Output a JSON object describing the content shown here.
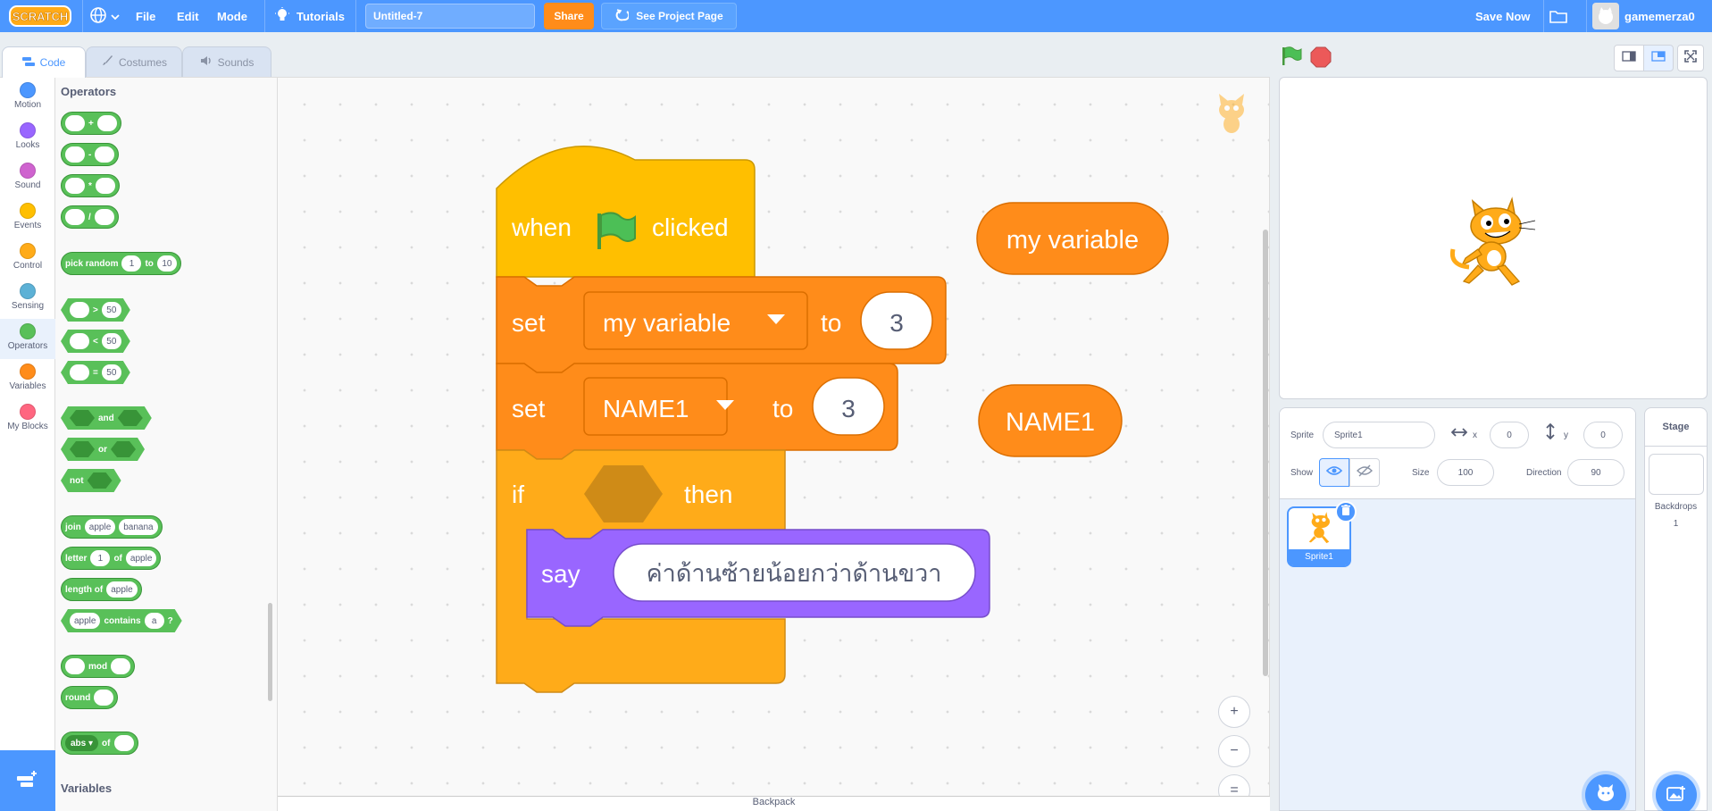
{
  "menubar": {
    "logo_text": "SCRATCH",
    "file": "File",
    "edit": "Edit",
    "mode": "Mode",
    "tutorials": "Tutorials",
    "project_title": "Untitled-7",
    "share": "Share",
    "see_project_page": "See Project Page",
    "save_now": "Save Now",
    "username": "gamemerza0"
  },
  "tabs": {
    "code": "Code",
    "costumes": "Costumes",
    "sounds": "Sounds"
  },
  "categories": [
    {
      "label": "Motion",
      "color": "#4c97ff"
    },
    {
      "label": "Looks",
      "color": "#9966ff"
    },
    {
      "label": "Sound",
      "color": "#cf63cf"
    },
    {
      "label": "Events",
      "color": "#ffbf00"
    },
    {
      "label": "Control",
      "color": "#ffab19"
    },
    {
      "label": "Sensing",
      "color": "#5cb1d6"
    },
    {
      "label": "Operators",
      "color": "#59c059"
    },
    {
      "label": "Variables",
      "color": "#ff8c1a"
    },
    {
      "label": "My Blocks",
      "color": "#ff6680"
    }
  ],
  "palette": {
    "heading": "Operators",
    "heading2": "Variables",
    "add": "+",
    "sub": "-",
    "mul": "*",
    "div": "/",
    "pick_random": "pick random",
    "pick_from": "1",
    "pick_to_word": "to",
    "pick_to": "10",
    "gt": ">",
    "lt": "<",
    "eq": "=",
    "cmp_value": "50",
    "and": "and",
    "or": "or",
    "not": "not",
    "join": "join",
    "join_a": "apple",
    "join_b": "banana",
    "letter": "letter",
    "letter_n": "1",
    "of": "of",
    "letter_of": "apple",
    "length_of": "length of",
    "length_val": "apple",
    "contains_a": "apple",
    "contains": "contains",
    "contains_b": "a",
    "contains_q": "?",
    "mod": "mod",
    "round": "round",
    "abs": "abs",
    "abs_of": "of"
  },
  "script": {
    "hat_when": "when",
    "hat_clicked": "clicked",
    "set1_word": "set",
    "set1_var": "my variable",
    "set1_to": "to",
    "set1_value": "3",
    "set2_word": "set",
    "set2_var": "NAME1",
    "set2_to": "to",
    "set2_value": "3",
    "if_word": "if",
    "then_word": "then",
    "say_word": "say",
    "say_text": "ค่าด้านซ้ายน้อยกว่าด้านขวา",
    "reporter1": "my variable",
    "reporter2": "NAME1"
  },
  "zoom": {
    "in": "+",
    "out": "−",
    "reset": "="
  },
  "backpack": {
    "label": "Backpack"
  },
  "sprite_info": {
    "sprite_label": "Sprite",
    "sprite_name": "Sprite1",
    "x_label": "x",
    "x_value": "0",
    "y_label": "y",
    "y_value": "0",
    "show_label": "Show",
    "size_label": "Size",
    "size_value": "100",
    "direction_label": "Direction",
    "direction_value": "90"
  },
  "sprites": [
    {
      "name": "Sprite1"
    }
  ],
  "stage_pane": {
    "title": "Stage",
    "backdrops_label": "Backdrops",
    "backdrops_count": "1"
  },
  "colors": {
    "brand_blue": "#4c97ff",
    "events": "#ffbf00",
    "control": "#ffab19",
    "variables": "#ff8c1a",
    "looks": "#9966ff",
    "operators": "#59c059"
  }
}
